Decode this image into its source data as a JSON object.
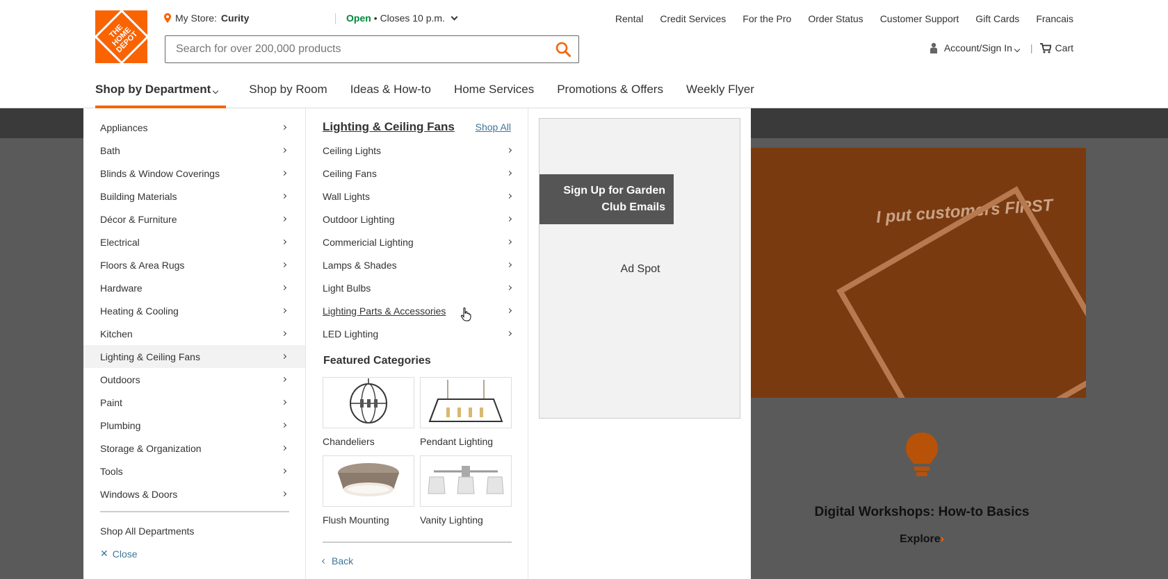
{
  "header": {
    "logo_text": "THE HOME DEPOT",
    "store_label": "My Store:",
    "store_name": "Curity",
    "open_status": "Open",
    "hours": "• Closes 10 p.m.",
    "utility_links": [
      "Rental",
      "Credit Services",
      "For the Pro",
      "Order Status",
      "Customer Support",
      "Gift Cards",
      "Francais"
    ],
    "search_placeholder": "Search for over 200,000 products",
    "account_label": "Account/Sign In",
    "cart_label": "Cart",
    "brand_color": "#f96302"
  },
  "nav": {
    "items": [
      "Shop by Department",
      "Shop by Room",
      "Ideas & How-to",
      "Home Services",
      "Promotions & Offers",
      "Weekly Flyer"
    ]
  },
  "menu": {
    "departments": [
      "Appliances",
      "Bath",
      "Blinds & Window Coverings",
      "Building Materials",
      "Décor & Furniture",
      "Electrical",
      "Floors & Area Rugs",
      "Hardware",
      "Heating & Cooling",
      "Kitchen",
      "Lighting & Ceiling Fans",
      "Outdoors",
      "Paint",
      "Plumbing",
      "Storage & Organization",
      "Tools",
      "Windows & Doors"
    ],
    "selected_department": "Lighting & Ceiling Fans",
    "shop_all_departments": "Shop All Departments",
    "close_label": "Close",
    "category_title": "Lighting & Ceiling Fans",
    "shop_all": "Shop All",
    "subcategories": [
      "Ceiling Lights",
      "Ceiling Fans",
      "Wall Lights",
      "Outdoor Lighting",
      "Commericial Lighting",
      "Lamps & Shades",
      "Light Bulbs",
      "Lighting Parts & Accessories",
      "LED Lighting"
    ],
    "featured_title": "Featured Categories",
    "featured": [
      "Chandeliers",
      "Pendant Lighting",
      "Flush Mounting",
      "Vanity Lighting"
    ],
    "back_label": "Back"
  },
  "ad": {
    "button_text": "Sign Up for Garden Club Emails",
    "spot_label": "Ad Spot"
  },
  "background": {
    "hero_text": "I put customers FIRST",
    "workshop_title": "Digital Workshops: How-to Basics",
    "explore_label": "Explore"
  }
}
